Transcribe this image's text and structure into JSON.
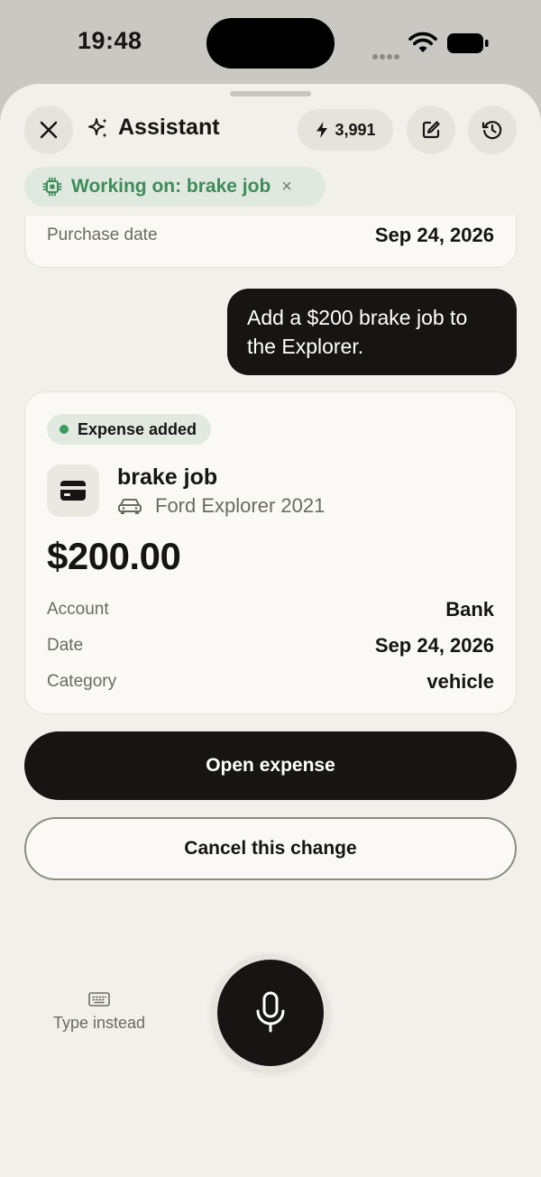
{
  "status_bar": {
    "time": "19:48"
  },
  "header": {
    "title": "Assistant",
    "credits": "3,991"
  },
  "context_chip": {
    "label": "Working on: brake job",
    "close": "×"
  },
  "previous_card": {
    "label": "Purchase date",
    "value": "Sep 24, 2026"
  },
  "user_message": {
    "text": "Add a $200 brake job to the Explorer."
  },
  "expense_card": {
    "status": "Expense added",
    "name": "brake job",
    "vehicle": "Ford Explorer 2021",
    "amount": "$200.00",
    "details": [
      {
        "label": "Account",
        "value": "Bank"
      },
      {
        "label": "Date",
        "value": "Sep 24, 2026"
      },
      {
        "label": "Category",
        "value": "vehicle"
      }
    ]
  },
  "actions": {
    "open_expense": "Open expense",
    "cancel_change": "Cancel this change"
  },
  "composer": {
    "type_instead": "Type instead"
  },
  "colors": {
    "accent_green": "#3d8c5a",
    "dark": "#161514",
    "sheet_bg": "#f2f0ea"
  }
}
